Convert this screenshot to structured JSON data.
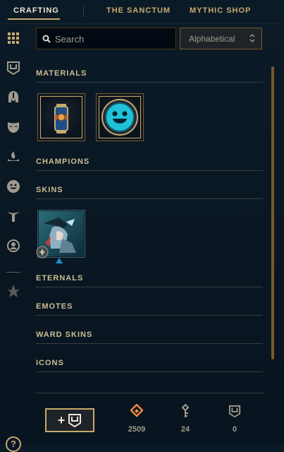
{
  "tabs": [
    {
      "label": "CRAFTING",
      "active": true
    },
    {
      "label": "THE SANCTUM",
      "active": false
    },
    {
      "label": "MYTHIC SHOP",
      "active": false
    }
  ],
  "sidebar": {
    "icons": [
      "grid-icon",
      "chest-icon",
      "champion-helmet-icon",
      "skin-mask-icon",
      "ward-icon",
      "emote-icon",
      "summoner-spells-icon",
      "profile-icon-icon",
      "mythic-icon"
    ],
    "help_label": "?"
  },
  "search": {
    "placeholder": "Search",
    "value": ""
  },
  "sort": {
    "selected": "Alphabetical"
  },
  "sections": {
    "materials": "MATERIALS",
    "champions": "CHAMPIONS",
    "skins": "SKINS",
    "eternals": "ETERNALS",
    "emotes": "EMOTES",
    "ward_skins": "WARD SKINS",
    "icons": "ICONS"
  },
  "materials": [
    {
      "name": "key-fragment-capsule",
      "icon": "capsule-icon"
    },
    {
      "name": "emote-orb",
      "icon": "smiley-emote-icon"
    }
  ],
  "skins": [
    {
      "name": "skin-shard",
      "icon": "skin-art",
      "rarity": "rarity-gem-icon"
    }
  ],
  "footer": {
    "add_icon": "chest-icon",
    "add_label": "+",
    "currencies": [
      {
        "name": "orange-essence",
        "icon": "orange-essence-icon",
        "value": "2509"
      },
      {
        "name": "keys",
        "icon": "key-icon",
        "value": "24"
      },
      {
        "name": "chests",
        "icon": "chest-icon",
        "value": "0"
      }
    ]
  },
  "colors": {
    "gold": "#c8aa6e",
    "gold_light": "#f0e6d2",
    "gold_dark": "#785a28",
    "background": "#0a1824",
    "orange_essence": "#f0883e",
    "emote_blue": "#1fc2d6"
  }
}
